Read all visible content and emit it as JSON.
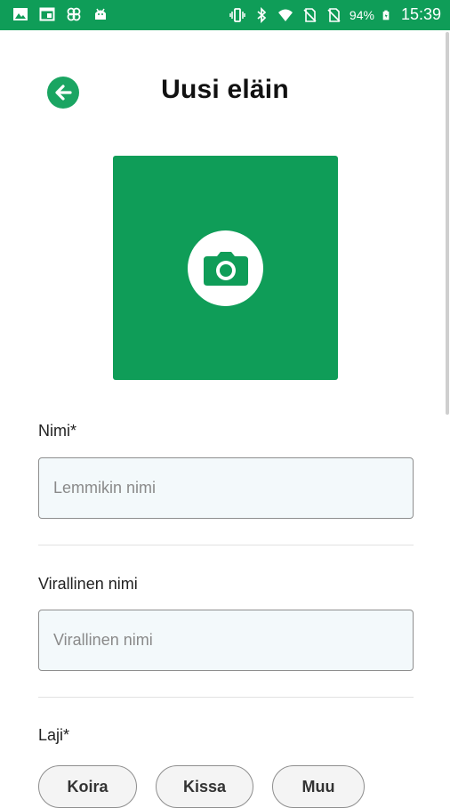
{
  "status_bar": {
    "battery_percent": "94%",
    "time": "15:39",
    "icons_left": [
      "image-icon",
      "browser-window-icon",
      "pinwheel-app-icon",
      "android-icon"
    ],
    "icons_right": [
      "vibrate-icon",
      "bluetooth-icon",
      "wifi-icon",
      "no-sim-icon",
      "no-sim-icon",
      "battery-icon"
    ]
  },
  "header": {
    "title": "Uusi eläin",
    "back_icon": "arrow-left-icon"
  },
  "photo": {
    "icon": "camera-icon"
  },
  "form": {
    "name": {
      "label": "Nimi*",
      "placeholder": "Lemmikin nimi",
      "value": ""
    },
    "official_name": {
      "label": "Virallinen nimi",
      "placeholder": "Virallinen nimi",
      "value": ""
    },
    "species": {
      "label": "Laji*",
      "options": [
        "Koira",
        "Kissa",
        "Muu"
      ]
    }
  },
  "colors": {
    "accent": "#0f9d58",
    "input_background": "#f3f9fb",
    "input_border": "#8e8e8e"
  }
}
